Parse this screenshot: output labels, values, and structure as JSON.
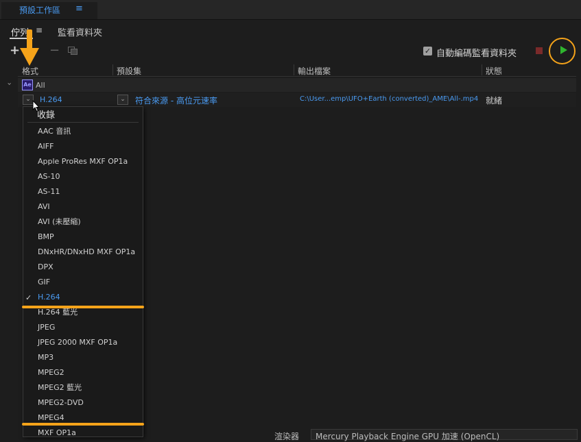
{
  "top_tab": {
    "label": "預設工作區",
    "menu_glyph": "≡"
  },
  "panel_tabs": {
    "queue": "佇列",
    "queue_menu_glyph": "≡",
    "watch": "監看資料夾"
  },
  "toolbar": {
    "add_glyph": "+",
    "remove_glyph": "−",
    "auto_encode_label": "自動編碼監看資料夾",
    "auto_encode_checked": true,
    "check_glyph": "✓"
  },
  "columns": {
    "format": "格式",
    "preset": "預設集",
    "output": "輸出檔案",
    "status": "狀態"
  },
  "source": {
    "badge": "Ae",
    "name": "All",
    "expand_glyph": "›"
  },
  "output_row": {
    "dropdown_glyph": "⌄",
    "format": "H.264",
    "preset": "符合來源 - 高位元速率",
    "file": "C:\\User...emp\\UFO+Earth (converted)_AME\\All-.mp4",
    "status": "就緒"
  },
  "format_menu": {
    "header": "收錄",
    "check_glyph": "✓",
    "items": [
      "AAC 音訊",
      "AIFF",
      "Apple ProRes MXF OP1a",
      "AS-10",
      "AS-11",
      "AVI",
      "AVI (未壓縮)",
      "BMP",
      "DNxHR/DNxHD MXF OP1a",
      "DPX",
      "GIF",
      "H.264",
      "H.264 藍光",
      "JPEG",
      "JPEG 2000 MXF OP1a",
      "MP3",
      "MPEG2",
      "MPEG2 藍光",
      "MPEG2-DVD",
      "MPEG4",
      "MXF OP1a"
    ],
    "selected": "H.264"
  },
  "renderer": {
    "label": "渲染器",
    "value": "Mercury Playback Engine GPU 加速 (OpenCL)"
  },
  "colors": {
    "accent": "#4a9bf2",
    "highlight": "#f5a31a",
    "play": "#2fb52f"
  }
}
